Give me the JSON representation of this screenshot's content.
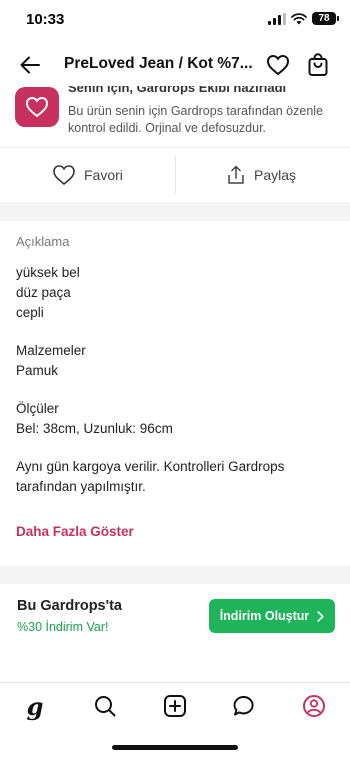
{
  "status_bar": {
    "time": "10:33",
    "battery": "78"
  },
  "nav": {
    "title": "PreLoved Jean / Kot %7..."
  },
  "guarantee": {
    "title": "Senin için, Gardrops Ekibi hazırladı",
    "text": "Bu ürün senin için Gardrops tarafından özenle kontrol edildi. Orjinal ve defosuzdur."
  },
  "actions": {
    "favorite_label": "Favori",
    "share_label": "Paylaş"
  },
  "description": {
    "heading": "Açıklama",
    "lines": [
      "yüksek bel",
      "düz paça",
      "cepli",
      "Malzemeler",
      "Pamuk",
      "Ölçüler",
      "Bel: 38cm, Uzunluk: 96cm",
      "Aynı gün kargoya verilir. Kontrolleri Gardrops",
      "tarafından yapılmıştır."
    ],
    "show_more": "Daha Fazla Göster"
  },
  "promo": {
    "title": "Bu Gardrops'ta",
    "subtitle": "%30 İndirim Var!",
    "button_label": "İndirim Oluştur"
  },
  "tab_bar": {
    "logo": "g"
  },
  "colors": {
    "brand": "#c8305f",
    "green": "#1fb45a",
    "green_text": "#1aa34a"
  }
}
